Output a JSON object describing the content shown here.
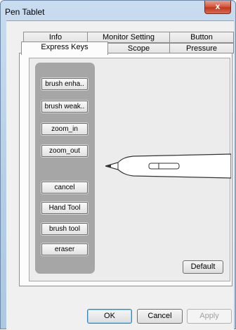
{
  "window": {
    "title": "Pen Tablet",
    "close_glyph": "x"
  },
  "tabs": {
    "row_back": [
      "Info",
      "Monitor Setting",
      "Button"
    ],
    "row_front": [
      "Express Keys",
      "Scope",
      "Pressure"
    ],
    "active": "Express Keys"
  },
  "express_keys": [
    "brush enha..",
    "brush weak..",
    "zoom_in",
    "zoom_out",
    "cancel",
    "Hand Tool",
    "brush tool",
    "eraser"
  ],
  "panel": {
    "default_label": "Default"
  },
  "footer": {
    "ok_label": "OK",
    "cancel_label": "Cancel",
    "apply_label": "Apply"
  }
}
